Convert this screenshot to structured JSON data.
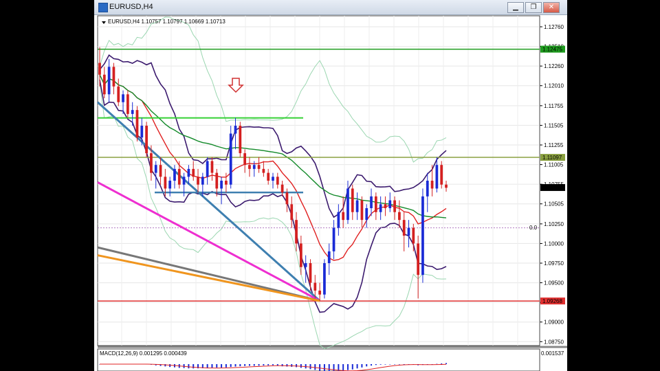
{
  "window": {
    "title": "EURUSD,H4"
  },
  "chart_data": {
    "type": "candlestick",
    "symbol_line": "EURUSD,H4  1.10757 1.10797 1.10669 1.10713",
    "ylim": [
      1.087,
      1.129
    ],
    "y_ticks": [
      "1.12760",
      "1.12510",
      "1.12260",
      "1.12010",
      "1.11755",
      "1.11505",
      "1.11255",
      "1.11005",
      "1.10755",
      "1.10505",
      "1.10250",
      "1.10000",
      "1.09750",
      "1.09500",
      "1.09250",
      "1.09000",
      "1.08750"
    ],
    "price_labels": [
      {
        "value": 1.12475,
        "text": "1.12475",
        "color": "#1e9c1e"
      },
      {
        "value": 1.11097,
        "text": "1.11097",
        "color": "#8aa040"
      },
      {
        "value": 1.10713,
        "text": "1.10713",
        "color": "#000000"
      },
      {
        "value": 1.09268,
        "text": "1.09268",
        "color": "#e03030"
      }
    ],
    "fib_label": "0.0",
    "macd": {
      "label": "MACD(12,26,9) 0.001295 0.000439",
      "top_value": "0.001537"
    },
    "colors": {
      "up": "#1a2bd6",
      "down": "#d42020",
      "bands": "#9ad6b0",
      "inner": "#3b1a6e",
      "ma_red": "#e02020",
      "ma_green": "#138a2a",
      "support": "#3e7fb0",
      "magenta": "#ee2ed0",
      "gray": "#777777",
      "orange": "#f0951e",
      "hline_green": "#1e9c1e",
      "hline_olive": "#8aa040",
      "hline_red": "#e03030",
      "hline_blue": "#3e7fb0",
      "hline_lime": "#35d035"
    },
    "candles": [
      [
        1.123,
        1.125,
        1.12,
        1.1215
      ],
      [
        1.1215,
        1.1225,
        1.1185,
        1.119
      ],
      [
        1.119,
        1.1235,
        1.118,
        1.1225
      ],
      [
        1.1225,
        1.123,
        1.119,
        1.12
      ],
      [
        1.12,
        1.121,
        1.1175,
        1.118
      ],
      [
        1.118,
        1.1195,
        1.1165,
        1.119
      ],
      [
        1.119,
        1.1195,
        1.116,
        1.1165
      ],
      [
        1.1165,
        1.118,
        1.115,
        1.117
      ],
      [
        1.117,
        1.1175,
        1.113,
        1.1135
      ],
      [
        1.1135,
        1.116,
        1.1125,
        1.115
      ],
      [
        1.115,
        1.1155,
        1.111,
        1.1115
      ],
      [
        1.1115,
        1.1125,
        1.108,
        1.109
      ],
      [
        1.109,
        1.1105,
        1.107,
        1.11
      ],
      [
        1.11,
        1.111,
        1.1075,
        1.1085
      ],
      [
        1.1085,
        1.1095,
        1.106,
        1.107
      ],
      [
        1.107,
        1.1085,
        1.106,
        1.108
      ],
      [
        1.108,
        1.11,
        1.107,
        1.1095
      ],
      [
        1.1095,
        1.1105,
        1.107,
        1.1075
      ],
      [
        1.1075,
        1.109,
        1.106,
        1.1085
      ],
      [
        1.1085,
        1.11,
        1.1075,
        1.1095
      ],
      [
        1.1095,
        1.1105,
        1.108,
        1.1085
      ],
      [
        1.1085,
        1.1095,
        1.1065,
        1.1075
      ],
      [
        1.1075,
        1.109,
        1.106,
        1.1085
      ],
      [
        1.1085,
        1.111,
        1.1075,
        1.1105
      ],
      [
        1.1105,
        1.111,
        1.108,
        1.109
      ],
      [
        1.109,
        1.1095,
        1.106,
        1.107
      ],
      [
        1.107,
        1.1085,
        1.105,
        1.108
      ],
      [
        1.108,
        1.109,
        1.1065,
        1.1075
      ],
      [
        1.1075,
        1.115,
        1.107,
        1.114
      ],
      [
        1.114,
        1.116,
        1.112,
        1.115
      ],
      [
        1.115,
        1.1155,
        1.111,
        1.1115
      ],
      [
        1.1115,
        1.112,
        1.109,
        1.11
      ],
      [
        1.11,
        1.111,
        1.1085,
        1.1095
      ],
      [
        1.1095,
        1.1105,
        1.1085,
        1.11
      ],
      [
        1.11,
        1.111,
        1.109,
        1.1095
      ],
      [
        1.1095,
        1.1105,
        1.1085,
        1.109
      ],
      [
        1.109,
        1.1095,
        1.1075,
        1.108
      ],
      [
        1.108,
        1.109,
        1.107,
        1.1085
      ],
      [
        1.1085,
        1.109,
        1.107,
        1.1075
      ],
      [
        1.1075,
        1.108,
        1.106,
        1.1065
      ],
      [
        1.1065,
        1.107,
        1.104,
        1.105
      ],
      [
        1.105,
        1.106,
        1.102,
        1.103
      ],
      [
        1.103,
        1.104,
        1.099,
        1.1
      ],
      [
        1.1,
        1.101,
        1.096,
        1.097
      ],
      [
        1.097,
        1.0985,
        1.095,
        1.0975
      ],
      [
        1.0975,
        1.098,
        1.094,
        1.095
      ],
      [
        1.095,
        1.096,
        1.093,
        1.094
      ],
      [
        1.094,
        1.095,
        1.0927,
        1.0935
      ],
      [
        1.0935,
        1.098,
        1.093,
        1.0975
      ],
      [
        1.0975,
        1.1,
        1.096,
        1.099
      ],
      [
        1.099,
        1.103,
        1.098,
        1.102
      ],
      [
        1.102,
        1.105,
        1.101,
        1.104
      ],
      [
        1.104,
        1.106,
        1.102,
        1.103
      ],
      [
        1.103,
        1.108,
        1.1025,
        1.107
      ],
      [
        1.107,
        1.1075,
        1.103,
        1.104
      ],
      [
        1.104,
        1.1065,
        1.103,
        1.1055
      ],
      [
        1.1055,
        1.106,
        1.102,
        1.103
      ],
      [
        1.103,
        1.105,
        1.102,
        1.1045
      ],
      [
        1.1045,
        1.107,
        1.1035,
        1.106
      ],
      [
        1.106,
        1.1065,
        1.103,
        1.104
      ],
      [
        1.104,
        1.106,
        1.103,
        1.105
      ],
      [
        1.105,
        1.106,
        1.1035,
        1.1045
      ],
      [
        1.1045,
        1.1065,
        1.104,
        1.1055
      ],
      [
        1.1055,
        1.106,
        1.103,
        1.104
      ],
      [
        1.104,
        1.1055,
        1.102,
        1.103
      ],
      [
        1.103,
        1.104,
        1.099,
        1.101
      ],
      [
        1.101,
        1.103,
        1.0995,
        1.102
      ],
      [
        1.102,
        1.1025,
        1.099,
        1.1
      ],
      [
        1.1,
        1.101,
        1.093,
        1.096
      ],
      [
        1.096,
        1.107,
        1.095,
        1.106
      ],
      [
        1.106,
        1.109,
        1.104,
        1.108
      ],
      [
        1.108,
        1.11,
        1.106,
        1.107
      ],
      [
        1.107,
        1.111,
        1.1065,
        1.11
      ],
      [
        1.11,
        1.1105,
        1.107,
        1.1075
      ],
      [
        1.1075,
        1.108,
        1.1066,
        1.1071
      ]
    ]
  }
}
